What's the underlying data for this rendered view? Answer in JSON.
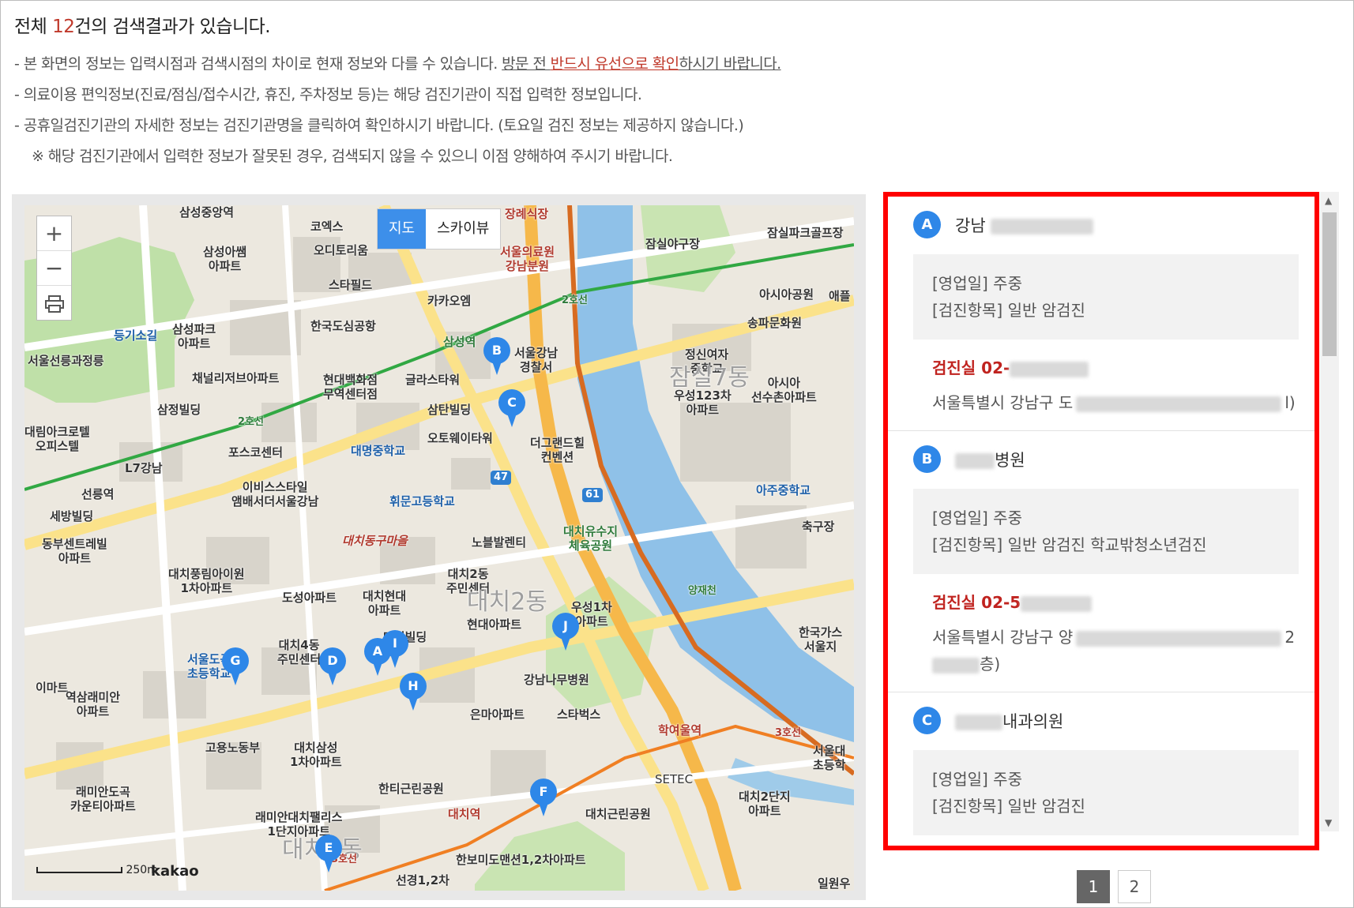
{
  "summary": {
    "pre": "전체 ",
    "count": "12",
    "post": "건의 검색결과가 있습니다."
  },
  "notices": {
    "n1_pre": "- 본 화면의 정보는 입력시점과 검색시점의 차이로 현재 정보와 다를 수 있습니다.  ",
    "n1_u1": "방문 전 ",
    "n1_red": "반드시 유선으로 확인",
    "n1_u2": "하시기 바랍니다.",
    "n2": "- 의료이용 편익정보(진료/점심/접수시간, 휴진, 주차정보 등)는 해당 검진기관이 직접 입력한 정보입니다.",
    "n3": "- 공휴일검진기관의 자세한 정보는 검진기관명을 클릭하여 확인하시기 바랍니다. (토요일 검진 정보는 제공하지 않습니다.)",
    "n4": "※ 해당 검진기관에서 입력한 정보가 잘못된 경우, 검색되지 않을 수 있으니 이점 양해하여 주시기 바랍니다."
  },
  "map": {
    "zoom_in": "+",
    "zoom_out": "−",
    "print_icon": "print-icon",
    "type_map": "지도",
    "type_sky": "스카이뷰",
    "scale": "250m",
    "brand": "kakao",
    "labels": {
      "l1": "삼성중앙역",
      "l2": "코엑스",
      "l3": "오디토리움",
      "l4": "스타필드",
      "l5": "카카오엠",
      "l6": "한국도심공항",
      "l7": "삼성아쌤\n아파트",
      "l8": "등기소길",
      "l9": "삼성파크\n아파트",
      "l10": "서울선릉과정릉",
      "l11": "채널리저브아파트",
      "l12": "현대백화점\n무역센터점",
      "l13": "글라스타워",
      "l14": "삼성역",
      "l15": "삼정빌딩",
      "l16": "대림아크로텔\n오피스텔",
      "l17": "포스코센터",
      "l18": "L7강남",
      "l19": "선릉역",
      "l20": "세방빌딩",
      "l21": "이비스스타일\n앰배서더서울강남",
      "l22": "대명중학교",
      "l23": "휘문고등학교",
      "l24": "삼탄빌딩",
      "l25": "오토웨이타워",
      "l26": "더그랜드힐\n컨벤션",
      "l27": "노블발렌티",
      "l28": "대치동구마을",
      "l29": "동부센트레빌\n아파트",
      "l30": "대치풍림아이원\n1차아파트",
      "l31": "도성아파트",
      "l32": "대치현대\n아파트",
      "l33": "대치2동\n주민센터",
      "l34": "대치2동",
      "l35": "우성1차\n아파트",
      "l36": "현대아파트",
      "l37": "강남나무병원",
      "l38": "태성빌딩",
      "l39": "대치4동\n주민센터",
      "l40": "서울도곡\n초등학교",
      "l41": "이마트",
      "l42": "역삼래미안\n아파트",
      "l43": "고용노동부",
      "l44": "대치삼성\n1차아파트",
      "l45": "은마아파트",
      "l46": "스타벅스",
      "l47": "학여울역",
      "l48": "SETEC",
      "l49": "한티근린공원",
      "l50": "래미안도곡\n카운티아파트",
      "l51": "래미안대치팰리스\n1단지아파트",
      "l52": "대치역",
      "l53": "대치근린공원",
      "l54": "한보미도맨션1,2차아파트",
      "l55": "선경1,2차",
      "l56": "대치1동",
      "l57": "대치2단지\n아파트",
      "l58": "서울대\n초등학",
      "l59": "일원우",
      "l60": "한국가스\n서울지",
      "l61": "축구장",
      "l62": "아주중학교",
      "l63": "대치유수지\n체육공원",
      "l64": "잠실야구장",
      "l65": "서울의료원\n강남분원",
      "l66": "장례식장",
      "l67": "잠실파크골프장",
      "l68": "아시아공원",
      "l69": "송파문화원",
      "l70": "정신여자\n중학교",
      "l71": "아시아\n선수촌아파트",
      "l72": "우성123차\n아파트",
      "l73": "서울강남\n경찰서",
      "l74": "잠실7동",
      "l75": "2호선",
      "l76": "2호선",
      "l77": "47",
      "l78": "61",
      "l79": "3호선",
      "l80": "양재천",
      "l81": "애플",
      "l82": "3호선"
    },
    "pins": [
      "A",
      "B",
      "C",
      "D",
      "E",
      "F",
      "G",
      "H",
      "J",
      "I"
    ]
  },
  "list": [
    {
      "badge": "A",
      "name": "강남",
      "biz": "[영업일] 주중",
      "exam": "[검진항목] 일반 암검진",
      "phone": "검진실 02-",
      "addr1": "서울특별시 강남구 도",
      "addr1_end": "l)"
    },
    {
      "badge": "B",
      "name": "병원",
      "biz": "[영업일] 주중",
      "exam": "[검진항목] 일반 암검진 학교밖청소년검진",
      "phone": "검진실  02-5",
      "addr1": "서울특별시 강남구 양",
      "addr1_end": "2",
      "addr2_end": "층)"
    },
    {
      "badge": "C",
      "name": "내과의원",
      "biz": "[영업일] 주중",
      "exam": "[검진항목] 일반 암검진"
    }
  ],
  "pager": [
    "1",
    "2"
  ]
}
